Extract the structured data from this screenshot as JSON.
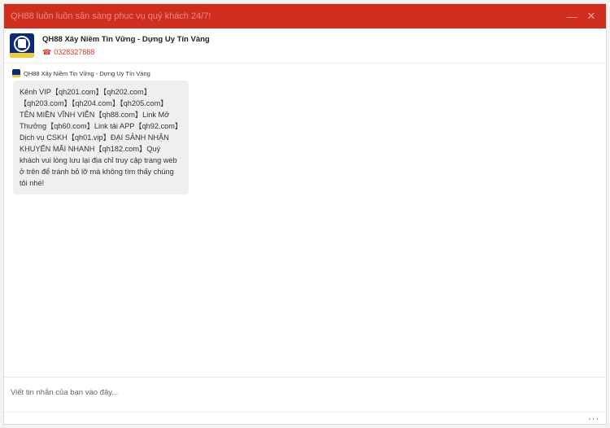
{
  "window": {
    "title": "QH88 luôn luôn sẵn sàng phục vụ quý khách 24/7!",
    "minimize_glyph": "—",
    "close_glyph": "✕"
  },
  "header": {
    "shop_name": "QH88 Xây Niềm Tin Vững - Dựng Uy Tín Vàng",
    "phone_icon": "☎",
    "phone": "0328327888",
    "avatar_icon": "qh88-logo-icon"
  },
  "conversation": {
    "sender": "QH88 Xây Niềm Tin Vững - Dựng Uy Tín Vàng",
    "message": "Kênh VIP【qh201.com】【qh202.com】【qh203.com】【qh204.com】【qh205.com】TÊN MIỀN VĨNH VIỄN【qh88.com】Link Mở Thưởng【qh60.com】Link tải APP【qh92.com】Dịch vụ CSKH【qh01.vip】ĐẠI SẢNH NHẬN KHUYẾN MÃI NHANH【qh182.com】Quý khách vui lòng lưu lại địa chỉ truy cập trang web ở trên để tránh bỏ lỡ mà không tìm thấy chúng tôi nhé!"
  },
  "composer": {
    "placeholder": "Viết tin nhắn của bạn vào đây..."
  },
  "footer": {
    "more_glyph": "···"
  },
  "colors": {
    "titlebar": "#cf2d1e",
    "accent_phone": "#d2382b",
    "bubble": "#efefef"
  }
}
